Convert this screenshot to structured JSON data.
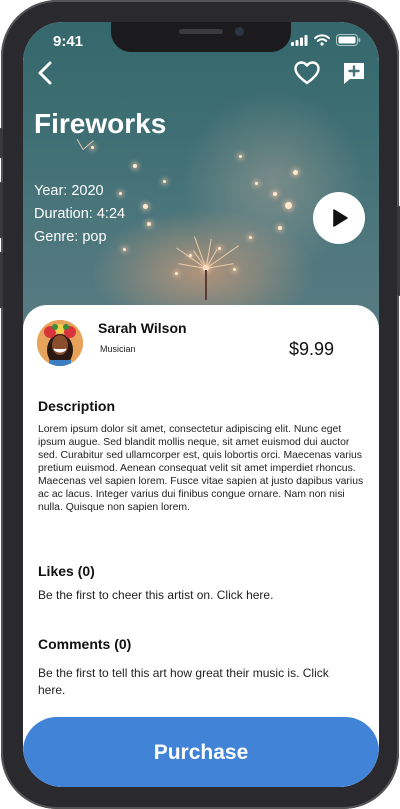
{
  "status_bar": {
    "time": "9:41"
  },
  "track": {
    "title": "Fireworks",
    "year_line": "Year: 2020",
    "duration_line": "Duration: 4:24",
    "genre_line": "Genre: pop"
  },
  "artist": {
    "name": "Sarah Wilson",
    "role": "Musician"
  },
  "price": "$9.99",
  "description": {
    "title": "Description",
    "text": "Lorem ipsum dolor sit amet, consectetur adipiscing elit. Nunc eget ipsum augue. Sed blandit mollis neque, sit amet euismod dui auctor sed. Curabitur sed ullamcorper est, quis lobortis orci. Maecenas varius pretium euismod. Aenean consequat velit sit amet imperdiet rhoncus. Maecenas vel sapien lorem. Fusce vitae sapien at justo dapibus varius ac ac lacus. Integer varius dui finibus congue ornare. Nam non nisi nulla. Quisque non sapien lorem."
  },
  "likes": {
    "title": "Likes (0)",
    "text": "Be the first to cheer this artist on. Click here."
  },
  "comments": {
    "title": "Comments (0)",
    "text": "Be the first to tell this art how great their music is. Click here."
  },
  "purchase": {
    "label": "Purchase"
  },
  "icons": {
    "back": "chevron-left-icon",
    "favorite": "heart-outline-icon",
    "add_to_playlist": "message-plus-icon",
    "play": "play-icon"
  },
  "colors": {
    "accent": "#4183d7",
    "hero_tint": "#3f6f74",
    "text": "#111111"
  }
}
